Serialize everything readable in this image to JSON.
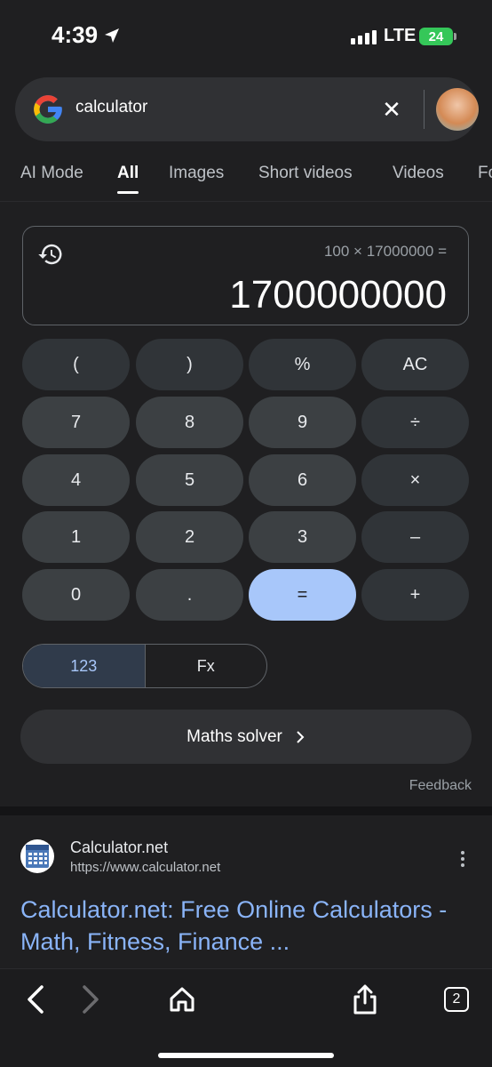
{
  "status_bar": {
    "time": "4:39",
    "network": "LTE",
    "battery": "24"
  },
  "search": {
    "query": "calculator"
  },
  "tabs": [
    {
      "label": "AI Mode"
    },
    {
      "label": "All"
    },
    {
      "label": "Images"
    },
    {
      "label": "Short videos"
    },
    {
      "label": "Videos"
    },
    {
      "label": "Fo"
    }
  ],
  "calculator": {
    "expression": "100 × 17000000 =",
    "result": "1700000000",
    "keys": [
      [
        "(",
        ")",
        "%",
        "AC"
      ],
      [
        "7",
        "8",
        "9",
        "÷"
      ],
      [
        "4",
        "5",
        "6",
        "×"
      ],
      [
        "1",
        "2",
        "3",
        "–"
      ],
      [
        "0",
        ".",
        "=",
        "+"
      ]
    ],
    "modes": {
      "basic": "123",
      "advanced": "Fx"
    },
    "solver_label": "Maths solver",
    "feedback": "Feedback"
  },
  "result": {
    "site_name": "Calculator.net",
    "url": "https://www.calculator.net",
    "title_line1": "Calculator.net: Free Online Calculators -",
    "title_line2": "Math, Fitness, Finance ..."
  },
  "toolbar": {
    "tab_count": "2"
  },
  "colors": {
    "accent": "#a8c7fa",
    "link": "#8ab4f8",
    "background": "#1f1f21"
  }
}
